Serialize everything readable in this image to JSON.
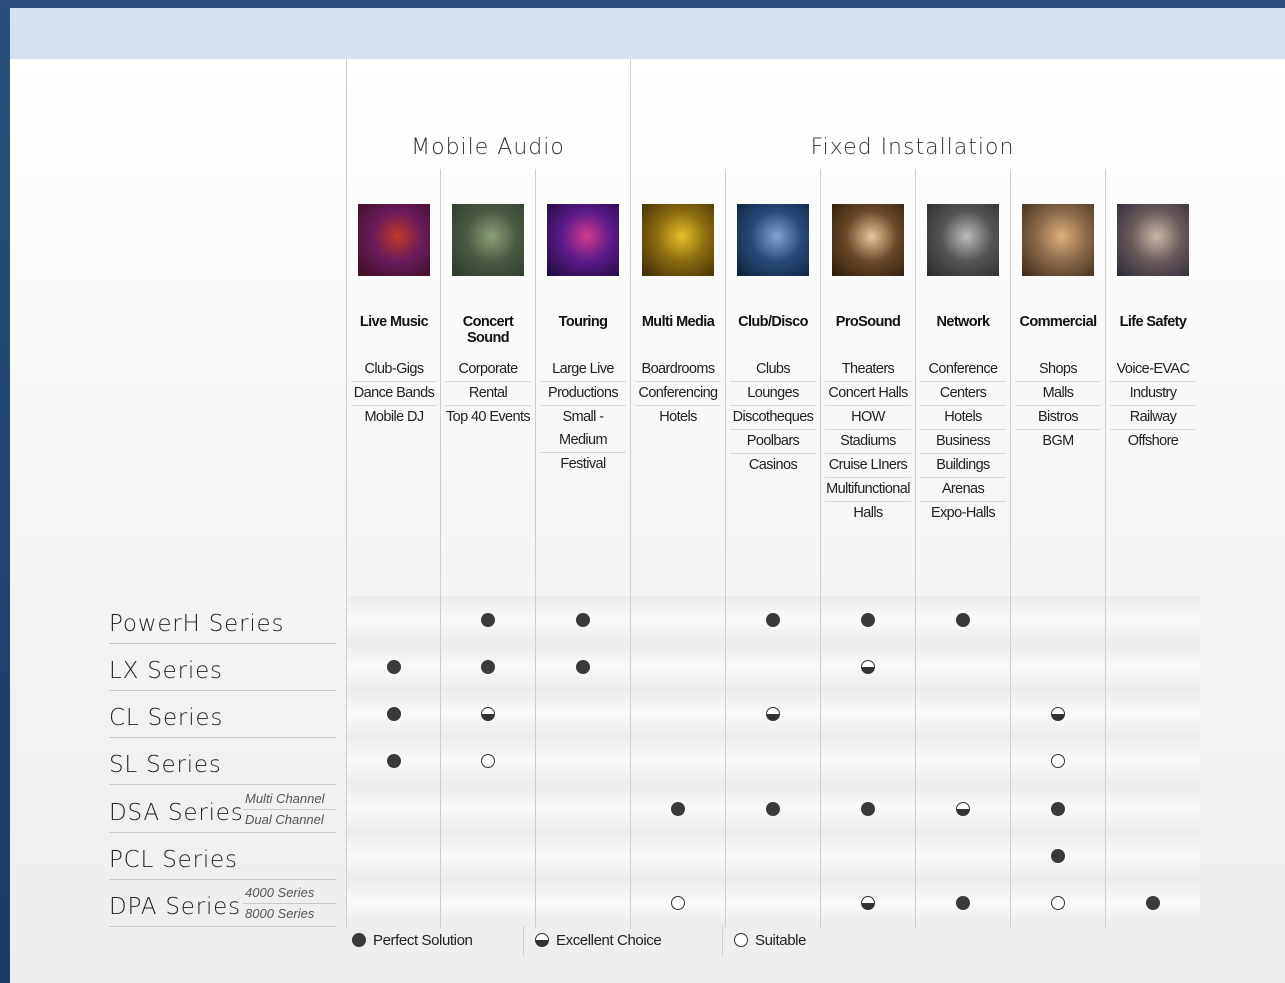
{
  "groups": {
    "mobile": "Mobile Audio",
    "fixed": "Fixed Installation"
  },
  "applications": [
    {
      "title": "Live Music",
      "uses": [
        "Club-Gigs",
        "Dance Bands",
        "Mobile DJ"
      ],
      "thumb_colors": [
        "#3b1020",
        "#c0392b",
        "#6a1a5a"
      ]
    },
    {
      "title": "Concert Sound",
      "uses": [
        "Corporate",
        "Rental",
        "Top 40 Events"
      ],
      "thumb_colors": [
        "#2d3a2a",
        "#8ea07a",
        "#4b5a44"
      ]
    },
    {
      "title": "Touring",
      "uses": [
        "Large Live",
        "Productions",
        "Small - Medium",
        "Festival"
      ],
      "thumb_colors": [
        "#1a0b3a",
        "#d23a8e",
        "#5a1a8a"
      ]
    },
    {
      "title": "Multi Media",
      "uses": [
        "Boardrooms",
        "Conferencing",
        "Hotels"
      ],
      "thumb_colors": [
        "#3a2a05",
        "#e8c02a",
        "#8a6a10"
      ]
    },
    {
      "title": "Club/Disco",
      "uses": [
        "Clubs",
        "Lounges",
        "Discotheques",
        "Poolbars",
        "Casinos"
      ],
      "thumb_colors": [
        "#0d1f3a",
        "#7fa4cf",
        "#2a4a7a"
      ]
    },
    {
      "title": "ProSound",
      "uses": [
        "Theaters",
        "Concert Halls",
        "HOW",
        "Stadiums",
        "Cruise LIners",
        "Multifunctional",
        "Halls"
      ],
      "thumb_colors": [
        "#2a1a0a",
        "#e6c89a",
        "#6a4a2a"
      ]
    },
    {
      "title": "Network",
      "uses": [
        "Conference",
        "Centers",
        "Hotels",
        "Business",
        "Buildings",
        "Arenas",
        "Expo-Halls"
      ],
      "thumb_colors": [
        "#2a2a2a",
        "#bcbcbc",
        "#555555"
      ]
    },
    {
      "title": "Commercial",
      "uses": [
        "Shops",
        "Malls",
        "Bistros",
        "BGM"
      ],
      "thumb_colors": [
        "#3a2a1a",
        "#e0b07a",
        "#8a6a4a"
      ]
    },
    {
      "title": "Life Safety",
      "uses": [
        "Voice-EVAC",
        "Industry",
        "Railway",
        "Offshore"
      ],
      "thumb_colors": [
        "#2a2a3a",
        "#c8b8a8",
        "#6a5a5a"
      ]
    }
  ],
  "series": [
    {
      "name": "PowerH Series",
      "subs": [],
      "ratings": [
        "",
        "full",
        "full",
        "",
        "full",
        "full",
        "full",
        "",
        ""
      ]
    },
    {
      "name": "LX Series",
      "subs": [],
      "ratings": [
        "full",
        "full",
        "full",
        "",
        "",
        "half",
        "",
        "",
        ""
      ]
    },
    {
      "name": "CL Series",
      "subs": [],
      "ratings": [
        "full",
        "half",
        "",
        "",
        "half",
        "",
        "",
        "half",
        ""
      ]
    },
    {
      "name": "SL Series",
      "subs": [],
      "ratings": [
        "full",
        "empty",
        "",
        "",
        "",
        "",
        "",
        "empty",
        ""
      ]
    },
    {
      "name": "DSA Series",
      "subs": [
        "Multi Channel",
        "Dual Channel"
      ],
      "ratings": [
        "",
        "",
        "",
        "full",
        "full",
        "full",
        "half",
        "full",
        ""
      ]
    },
    {
      "name": "PCL Series",
      "subs": [],
      "ratings": [
        "",
        "",
        "",
        "",
        "",
        "",
        "",
        "full",
        ""
      ]
    },
    {
      "name": "DPA Series",
      "subs": [
        "4000 Series",
        "8000 Series"
      ],
      "ratings": [
        "",
        "",
        "",
        "empty",
        "",
        "half",
        "full",
        "empty",
        "full"
      ]
    }
  ],
  "legend": [
    {
      "symbol": "full",
      "label": "Perfect Solution"
    },
    {
      "symbol": "half",
      "label": "Excellent Choice"
    },
    {
      "symbol": "empty",
      "label": "Suitable"
    }
  ],
  "colors": {
    "topbar": "#d4e1ee",
    "dot": "#3a3a3a",
    "border": "#2a4f7c"
  }
}
